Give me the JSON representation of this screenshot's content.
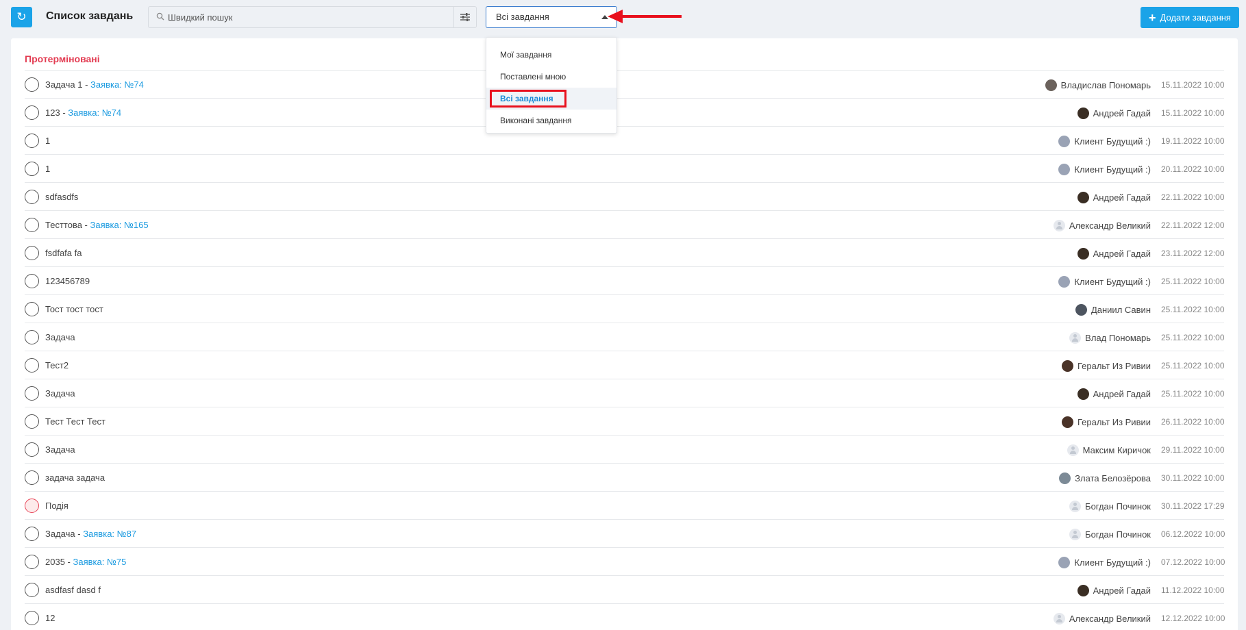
{
  "header": {
    "title": "Список завдань",
    "search_placeholder": "Швидкий пошук",
    "filter_selected": "Всі завдання",
    "add_button": "Додати завдання"
  },
  "dropdown": {
    "options": [
      "Мої завдання",
      "Поставлені мною",
      "Всі завдання",
      "Виконані завдання"
    ],
    "active_index": 2
  },
  "section": {
    "title": "Протерміновані"
  },
  "colors": {
    "accent": "#1aa3e8",
    "section_title": "#e33c52",
    "link": "#1a9ae0",
    "highlight": "#e8101d"
  },
  "tasks": [
    {
      "title": "Задача 1",
      "link": "Заявка: №74",
      "user": "Владислав Пономарь",
      "date": "15.11.2022 10:00",
      "avatar": "#6b625c"
    },
    {
      "title": "123",
      "link": "Заявка: №74",
      "user": "Андрей Гадай",
      "date": "15.11.2022 10:00",
      "avatar": "#3a2e24"
    },
    {
      "title": "1",
      "link": "",
      "user": "Клиент Будущий :)",
      "date": "19.11.2022 10:00",
      "avatar": "#9aa3b5"
    },
    {
      "title": "1",
      "link": "",
      "user": "Клиент Будущий :)",
      "date": "20.11.2022 10:00",
      "avatar": "#9aa3b5"
    },
    {
      "title": "sdfasdfs",
      "link": "",
      "user": "Андрей Гадай",
      "date": "22.11.2022 10:00",
      "avatar": "#3a2e24"
    },
    {
      "title": "Тесттова",
      "link": "Заявка: №165",
      "user": "Александр Великий",
      "date": "22.11.2022 12:00",
      "avatar": ""
    },
    {
      "title": "fsdfafa fa",
      "link": "",
      "user": "Андрей Гадай",
      "date": "23.11.2022 12:00",
      "avatar": "#3a2e24"
    },
    {
      "title": "123456789",
      "link": "",
      "user": "Клиент Будущий :)",
      "date": "25.11.2022 10:00",
      "avatar": "#9aa3b5"
    },
    {
      "title": "Тост тост тост",
      "link": "",
      "user": "Даниил Савин",
      "date": "25.11.2022 10:00",
      "avatar": "#4d5560"
    },
    {
      "title": "Задача",
      "link": "",
      "user": "Влад Пономарь",
      "date": "25.11.2022 10:00",
      "avatar": ""
    },
    {
      "title": "Тест2",
      "link": "",
      "user": "Геральт Из Ривии",
      "date": "25.11.2022 10:00",
      "avatar": "#4a3328"
    },
    {
      "title": "Задача",
      "link": "",
      "user": "Андрей Гадай",
      "date": "25.11.2022 10:00",
      "avatar": "#3a2e24"
    },
    {
      "title": "Тест Тест Тест",
      "link": "",
      "user": "Геральт Из Ривии",
      "date": "26.11.2022 10:00",
      "avatar": "#4a3328"
    },
    {
      "title": "Задача",
      "link": "",
      "user": "Максим Киричок",
      "date": "29.11.2022 10:00",
      "avatar": ""
    },
    {
      "title": "задача задача",
      "link": "",
      "user": "Злата Белозёрова",
      "date": "30.11.2022 10:00",
      "avatar": "#7c8a96"
    },
    {
      "title": "Подія",
      "link": "",
      "user": "Богдан Починок",
      "date": "30.11.2022 17:29",
      "avatar": "",
      "event": true
    },
    {
      "title": "Задача",
      "link": "Заявка: №87",
      "user": "Богдан Починок",
      "date": "06.12.2022 10:00",
      "avatar": ""
    },
    {
      "title": "2035",
      "link": "Заявка: №75",
      "user": "Клиент Будущий :)",
      "date": "07.12.2022 10:00",
      "avatar": "#9aa3b5"
    },
    {
      "title": "asdfasf dasd f",
      "link": "",
      "user": "Андрей Гадай",
      "date": "11.12.2022 10:00",
      "avatar": "#3a2e24"
    },
    {
      "title": "12",
      "link": "",
      "user": "Александр Великий",
      "date": "12.12.2022 10:00",
      "avatar": ""
    }
  ]
}
